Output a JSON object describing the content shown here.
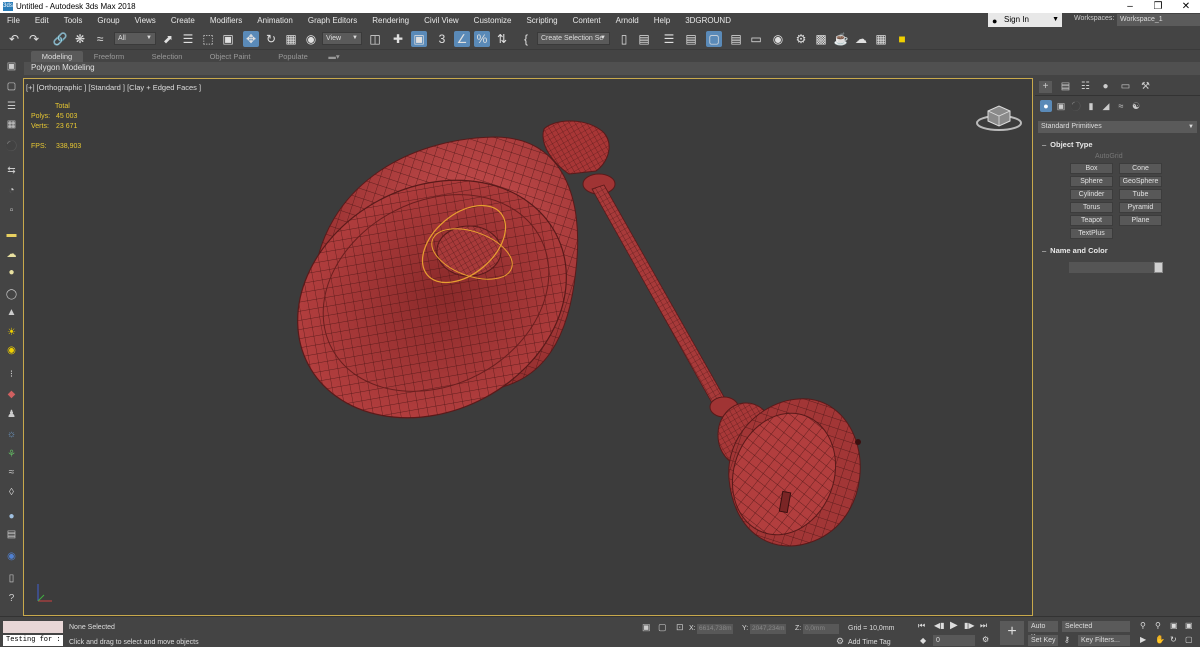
{
  "window": {
    "title": "Untitled - Autodesk 3ds Max 2018",
    "app_icon": "3ds"
  },
  "menubar": [
    "File",
    "Edit",
    "Tools",
    "Group",
    "Views",
    "Create",
    "Modifiers",
    "Animation",
    "Graph Editors",
    "Rendering",
    "Civil View",
    "Customize",
    "Scripting",
    "Content",
    "Arnold",
    "Help",
    "3DGROUND"
  ],
  "signin": {
    "label": "Sign In"
  },
  "workspace": {
    "label": "Workspaces:",
    "value": "Workspace_1"
  },
  "toolbar": {
    "selection_filter": "All",
    "ref_coord": "View",
    "named_selection": "Create Selection Se"
  },
  "ribbon": {
    "tabs": [
      "Modeling",
      "Freeform",
      "Selection",
      "Object Paint",
      "Populate"
    ],
    "active_tab": "Modeling",
    "panel_label": "Polygon Modeling"
  },
  "viewport": {
    "label": "[+] [Orthographic ] [Standard ] [Clay + Edged Faces ]",
    "stats": {
      "header": "Total",
      "polys_label": "Polys:",
      "polys": "45 003",
      "verts_label": "Verts:",
      "verts": "23 671",
      "fps_label": "FPS:",
      "fps": "338,903"
    }
  },
  "command_panel": {
    "primitive_type": "Standard Primitives",
    "object_type_title": "Object Type",
    "autogrid": "AutoGrid",
    "buttons": [
      "Box",
      "Cone",
      "Sphere",
      "GeoSphere",
      "Cylinder",
      "Tube",
      "Torus",
      "Pyramid",
      "Teapot",
      "Plane",
      "TextPlus"
    ],
    "name_color_title": "Name and Color"
  },
  "statusbar": {
    "maxscript": "Testing for :",
    "selection_status": "None Selected",
    "prompt": "Click and drag to select and move objects",
    "x_label": "X:",
    "x_value": "6614,738m",
    "y_label": "Y:",
    "y_value": "2047,234m",
    "z_label": "Z:",
    "z_value": "0,0mm",
    "grid": "Grid = 10,0mm",
    "add_time_tag": "Add Time Tag",
    "frame": "0",
    "auto_key": "Auto Key",
    "set_key": "Set Key",
    "key_mode": "Selected",
    "key_filters": "Key Filters..."
  },
  "colors": {
    "accent": "#5a8ab8",
    "viewport_border": "#c8a94c",
    "model": "#b23a3a",
    "stats": "#e8c832"
  }
}
